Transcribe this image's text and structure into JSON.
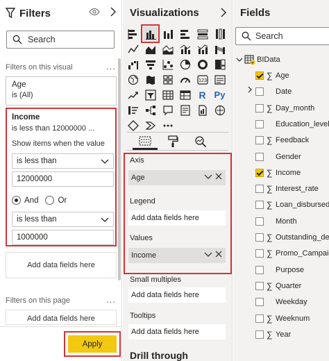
{
  "filters": {
    "title": "Filters",
    "search_placeholder": "Search",
    "section_visual": "Filters on this visual",
    "more": "...",
    "age_card": {
      "name": "Age",
      "desc": "is (All)"
    },
    "income_card": {
      "name": "Income",
      "desc": "is less than 12000000 ...",
      "show_label": "Show items when the value",
      "condition1": "is less than",
      "value1": "12000000",
      "logic_and": "And",
      "logic_or": "Or",
      "logic_selected": "And",
      "condition2": "is less than",
      "value2": "1000000"
    },
    "add_fields_visual": "Add data fields here",
    "section_page": "Filters on this page",
    "add_fields_page": "Add data fields here",
    "apply_label": "Apply"
  },
  "visualizations": {
    "title": "Visualizations",
    "selected_icon": "clustered-column-chart-icon",
    "icons": [
      "stacked-bar-chart-icon",
      "clustered-column-chart-icon",
      "stacked-column-chart-icon",
      "clustered-bar-chart-icon",
      "100-stacked-bar-chart-icon",
      "100-stacked-column-chart-icon",
      "line-chart-icon",
      "area-chart-icon",
      "stacked-area-chart-icon",
      "line-and-column-chart-icon",
      "line-and-stacked-column-chart-icon",
      "ribbon-chart-icon",
      "waterfall-chart-icon",
      "funnel-chart-icon",
      "scatter-chart-icon",
      "pie-chart-icon",
      "donut-chart-icon",
      "treemap-icon",
      "map-icon",
      "filled-map-icon",
      "shape-map-icon",
      "gauge-icon",
      "card-icon",
      "multi-row-card-icon",
      "kpi-icon",
      "slicer-icon",
      "table-icon",
      "matrix-icon",
      "r-visual-icon",
      "python-visual-icon",
      "key-influencers-icon",
      "decomposition-tree-icon",
      "qa-icon",
      "smart-narrative-icon",
      "paginated-report-icon",
      "arcgis-map-icon",
      "power-apps-icon",
      "power-automate-icon",
      "more-visuals-icon"
    ],
    "icon_labels": {
      "r": "R",
      "py": "Py"
    },
    "wells": {
      "axis_label": "Axis",
      "axis_field": "Age",
      "legend_label": "Legend",
      "legend_placeholder": "Add data fields here",
      "values_label": "Values",
      "values_field": "Income",
      "small_multiples_label": "Small multiples",
      "small_multiples_placeholder": "Add data fields here",
      "tooltips_label": "Tooltips",
      "tooltips_placeholder": "Add data fields here"
    },
    "drill_through": "Drill through"
  },
  "fields": {
    "title": "Fields",
    "search_placeholder": "Search",
    "table_name": "BIData",
    "items": [
      {
        "name": "Age",
        "checked": true,
        "sigma": true
      },
      {
        "name": "Date",
        "checked": false,
        "sigma": false,
        "expandable": true
      },
      {
        "name": "Day_month",
        "checked": false,
        "sigma": true
      },
      {
        "name": "Education_level",
        "checked": false,
        "sigma": false
      },
      {
        "name": "Feedback",
        "checked": false,
        "sigma": true
      },
      {
        "name": "Gender",
        "checked": false,
        "sigma": false
      },
      {
        "name": "Income",
        "checked": true,
        "sigma": true
      },
      {
        "name": "Interest_rate",
        "checked": false,
        "sigma": true
      },
      {
        "name": "Loan_disbursed",
        "checked": false,
        "sigma": true
      },
      {
        "name": "Month",
        "checked": false,
        "sigma": false
      },
      {
        "name": "Outstanding_debt",
        "checked": false,
        "sigma": true
      },
      {
        "name": "Promo_Campaign",
        "checked": false,
        "sigma": true
      },
      {
        "name": "Purpose",
        "checked": false,
        "sigma": false
      },
      {
        "name": "Quarter",
        "checked": false,
        "sigma": true
      },
      {
        "name": "Weekday",
        "checked": false,
        "sigma": false
      },
      {
        "name": "Weeknum",
        "checked": false,
        "sigma": true
      },
      {
        "name": "Year",
        "checked": false,
        "sigma": true
      }
    ]
  },
  "colors": {
    "accent_yellow": "#f2c811",
    "highlight_red": "#d13438",
    "pane_gray": "#f3f2f1"
  }
}
